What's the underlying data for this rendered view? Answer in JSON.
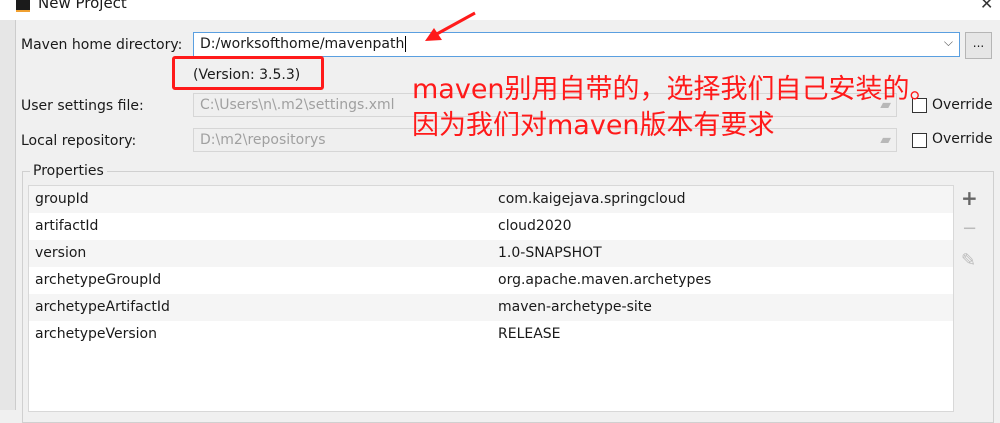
{
  "window": {
    "title": "New Project"
  },
  "form": {
    "maven_home_label": "Maven home directory:",
    "maven_home_value": "D:/worksofthome/mavenpath",
    "browse_label": "...",
    "version": "(Version: 3.5.3)",
    "user_settings_label": "User settings file:",
    "user_settings_value": "C:\\Users\\n\\.m2\\settings.xml",
    "local_repo_label": "Local repository:",
    "local_repo_value": "D:\\m2\\repositorys",
    "override_label": "Override"
  },
  "properties": {
    "title": "Properties",
    "rows": [
      {
        "key": "groupId",
        "value": "com.kaigejava.springcloud"
      },
      {
        "key": "artifactId",
        "value": "cloud2020"
      },
      {
        "key": "version",
        "value": "1.0-SNAPSHOT"
      },
      {
        "key": "archetypeGroupId",
        "value": "org.apache.maven.archetypes"
      },
      {
        "key": "archetypeArtifactId",
        "value": "maven-archetype-site"
      },
      {
        "key": "archetypeVersion",
        "value": "RELEASE"
      }
    ],
    "add": "+",
    "remove": "−",
    "edit": "✎"
  },
  "annotation": {
    "line1": "maven别用自带的，选择我们自己安装的。",
    "line2": "因为我们对maven版本有要求",
    "color": "#ff1a1a"
  }
}
